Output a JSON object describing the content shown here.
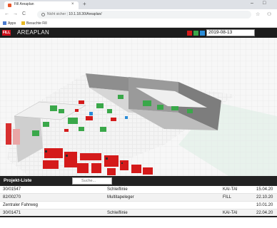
{
  "browser": {
    "tab_title": "Fill Areaplan",
    "tab_close": "×",
    "new_tab": "+",
    "url_insecure": "Nicht sicher",
    "url_sep": "|",
    "url_host": "10.1.18.30/Areaplan/",
    "bookmarks": [
      "Apps",
      "Besuchte Fill"
    ]
  },
  "app": {
    "title": "AREAPLAN",
    "logo_text": "FILL",
    "legend_colors": [
      "#d41a1a",
      "#3aa84a",
      "#2a8cd8"
    ],
    "date_value": "2019-08-13"
  },
  "project_list": {
    "title": "Projekt-Liste",
    "search_placeholder": "Suche...",
    "rows": [
      {
        "nr": "30/01547",
        "name": "Schleiflinie",
        "loc": "KAI-TAI",
        "date": "15.04.20"
      },
      {
        "nr": "82/00270",
        "name": "Multitapeleger",
        "loc": "FILL",
        "date": "22.10.20"
      },
      {
        "nr": "Zentraler Fahrweg",
        "name": "",
        "loc": "",
        "date": "10.01.20"
      },
      {
        "nr": "30/01471",
        "name": "Schleiflinie",
        "loc": "KAI-TAI",
        "date": "22.04.20"
      }
    ]
  }
}
